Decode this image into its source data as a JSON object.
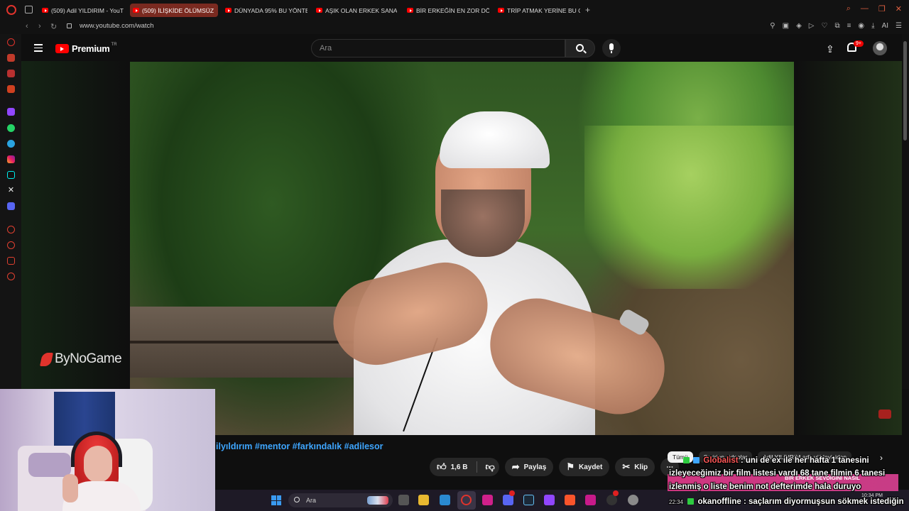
{
  "browser": {
    "tabs": [
      {
        "label": "(509) Adil YILDIRIM - YouT",
        "active": false
      },
      {
        "label": "(509) İLİŞKİDE ÖLÜMSÜZ",
        "active": true
      },
      {
        "label": "DÜNYADA 95% BU YÖNTE",
        "active": false
      },
      {
        "label": "AŞIK OLAN ERKEK SANA",
        "active": false
      },
      {
        "label": "BİR ERKEĞİN EN ZOR DÖN",
        "active": false
      },
      {
        "label": "TRİP ATMAK YERİNE BU C",
        "active": false
      }
    ],
    "new_tab": "+",
    "url": "www.youtube.com/watch",
    "ai_label": "AI",
    "accent": "#e0332c"
  },
  "youtube": {
    "logo_text": "Premium",
    "region": "TR",
    "search_placeholder": "Ara",
    "notification_count": "9+",
    "hashtags": "ilyıldırım #mentor #farkındalık #adilesor",
    "actions": {
      "likes": "1,6 B",
      "share": "Paylaş",
      "save": "Kaydet",
      "clip": "Klip",
      "more": "⋯"
    },
    "chips": [
      "Tümü",
      "Seriden videolar",
      "Adil YILDIRIM adlı yükleyiciden"
    ],
    "chip_arrow": "›"
  },
  "stream_overlay": {
    "watermark": "ByNoGame",
    "chat": [
      {
        "user": "Globalist",
        "message": "uni de ex ile her hafta 1 tanesini"
      },
      {
        "user": "",
        "message": "izleyeceğimiz bir film listesi vardı 68 tane filmin 6 tanesi"
      },
      {
        "user": "",
        "message": "izlenmiş o liste benim not defterimde hala duruyo"
      },
      {
        "time": "22:34",
        "user": "okanoffline",
        "message": "saçlarım diyormuşsun sökmek istediğin"
      }
    ],
    "notification_text": "BİR ERKEK SEVDİĞİNİ NASIL"
  },
  "taskbar": {
    "search_label": "Ara",
    "clock_time": "10:34 PM"
  }
}
